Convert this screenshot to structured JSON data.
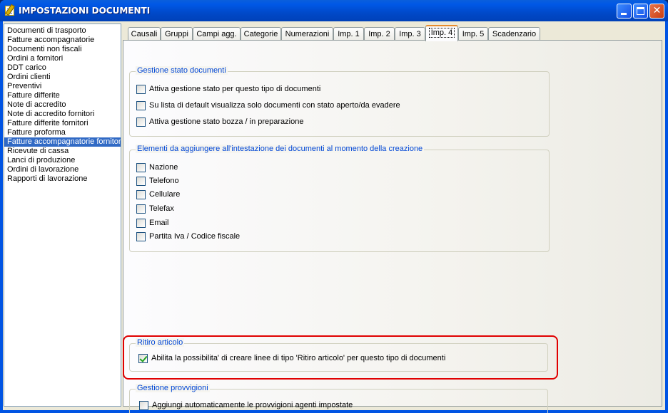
{
  "window": {
    "title": "IMPOSTAZIONI DOCUMENTI"
  },
  "doc_types": [
    {
      "label": "Documenti di trasporto",
      "selected": false
    },
    {
      "label": "Fatture accompagnatorie",
      "selected": false
    },
    {
      "label": "Documenti non fiscali",
      "selected": false
    },
    {
      "label": "Ordini a fornitori",
      "selected": false
    },
    {
      "label": "DDT carico",
      "selected": false
    },
    {
      "label": "Ordini clienti",
      "selected": false
    },
    {
      "label": "Preventivi",
      "selected": false
    },
    {
      "label": "Fatture differite",
      "selected": false
    },
    {
      "label": "Note di accredito",
      "selected": false
    },
    {
      "label": "Note di accredito fornitori",
      "selected": false
    },
    {
      "label": "Fatture differite fornitori",
      "selected": false
    },
    {
      "label": "Fatture proforma",
      "selected": false
    },
    {
      "label": "Fatture accompagnatorie fornitori",
      "selected": true
    },
    {
      "label": "Ricevute di cassa",
      "selected": false
    },
    {
      "label": "Lanci di produzione",
      "selected": false
    },
    {
      "label": "Ordini di lavorazione",
      "selected": false
    },
    {
      "label": "Rapporti di lavorazione",
      "selected": false
    }
  ],
  "tabs": [
    {
      "label": "Causali",
      "active": false
    },
    {
      "label": "Gruppi",
      "active": false
    },
    {
      "label": "Campi agg.",
      "active": false
    },
    {
      "label": "Categorie",
      "active": false
    },
    {
      "label": "Numerazioni",
      "active": false
    },
    {
      "label": "Imp. 1",
      "active": false
    },
    {
      "label": "Imp. 2",
      "active": false
    },
    {
      "label": "Imp. 3",
      "active": false
    },
    {
      "label": "Imp. 4",
      "active": true
    },
    {
      "label": "Imp. 5",
      "active": false
    },
    {
      "label": "Scadenzario",
      "active": false
    }
  ],
  "groups": {
    "stato": {
      "title": "Gestione stato documenti",
      "options": [
        {
          "label": "Attiva gestione stato per questo tipo di documenti",
          "checked": false
        },
        {
          "label": "Su lista di default visualizza solo documenti con stato aperto/da evadere",
          "checked": false
        },
        {
          "label": "Attiva gestione stato bozza / in preparazione",
          "checked": false
        }
      ]
    },
    "intestazione": {
      "title": "Elementi da aggiungere all'intestazione dei documenti al momento della creazione",
      "options": [
        {
          "label": "Nazione",
          "checked": false
        },
        {
          "label": "Telefono",
          "checked": false
        },
        {
          "label": "Cellulare",
          "checked": false
        },
        {
          "label": "Telefax",
          "checked": false
        },
        {
          "label": "Email",
          "checked": false
        },
        {
          "label": "Partita Iva / Codice fiscale",
          "checked": false
        }
      ]
    },
    "ritiro": {
      "title": "Ritiro articolo",
      "options": [
        {
          "label": "Abilita la possibilita' di creare linee di tipo 'Ritiro articolo' per questo tipo di documenti",
          "checked": true
        }
      ]
    },
    "provvigioni": {
      "title": "Gestione provvigioni",
      "options": [
        {
          "label": "Aggiungi automaticamente le provvigioni agenti impostate",
          "checked": false
        }
      ]
    }
  }
}
